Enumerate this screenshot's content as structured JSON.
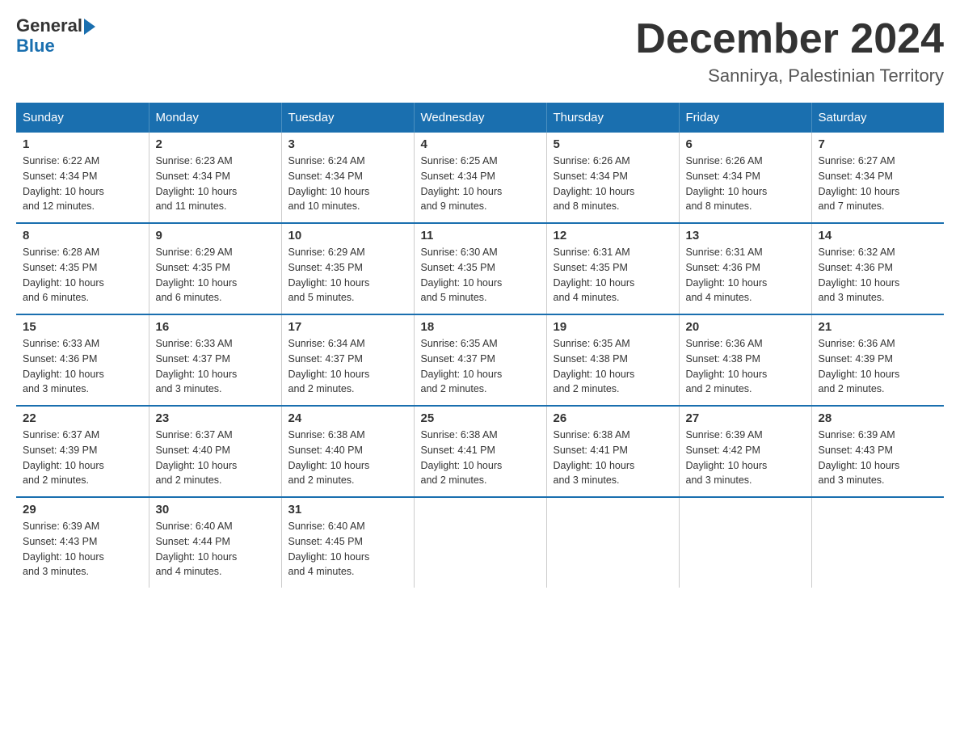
{
  "header": {
    "logo_line1": "General",
    "logo_line2": "Blue",
    "month_title": "December 2024",
    "location": "Sannirya, Palestinian Territory"
  },
  "days_of_week": [
    "Sunday",
    "Monday",
    "Tuesday",
    "Wednesday",
    "Thursday",
    "Friday",
    "Saturday"
  ],
  "weeks": [
    [
      {
        "day": "1",
        "sunrise": "6:22 AM",
        "sunset": "4:34 PM",
        "daylight": "10 hours and 12 minutes."
      },
      {
        "day": "2",
        "sunrise": "6:23 AM",
        "sunset": "4:34 PM",
        "daylight": "10 hours and 11 minutes."
      },
      {
        "day": "3",
        "sunrise": "6:24 AM",
        "sunset": "4:34 PM",
        "daylight": "10 hours and 10 minutes."
      },
      {
        "day": "4",
        "sunrise": "6:25 AM",
        "sunset": "4:34 PM",
        "daylight": "10 hours and 9 minutes."
      },
      {
        "day": "5",
        "sunrise": "6:26 AM",
        "sunset": "4:34 PM",
        "daylight": "10 hours and 8 minutes."
      },
      {
        "day": "6",
        "sunrise": "6:26 AM",
        "sunset": "4:34 PM",
        "daylight": "10 hours and 8 minutes."
      },
      {
        "day": "7",
        "sunrise": "6:27 AM",
        "sunset": "4:34 PM",
        "daylight": "10 hours and 7 minutes."
      }
    ],
    [
      {
        "day": "8",
        "sunrise": "6:28 AM",
        "sunset": "4:35 PM",
        "daylight": "10 hours and 6 minutes."
      },
      {
        "day": "9",
        "sunrise": "6:29 AM",
        "sunset": "4:35 PM",
        "daylight": "10 hours and 6 minutes."
      },
      {
        "day": "10",
        "sunrise": "6:29 AM",
        "sunset": "4:35 PM",
        "daylight": "10 hours and 5 minutes."
      },
      {
        "day": "11",
        "sunrise": "6:30 AM",
        "sunset": "4:35 PM",
        "daylight": "10 hours and 5 minutes."
      },
      {
        "day": "12",
        "sunrise": "6:31 AM",
        "sunset": "4:35 PM",
        "daylight": "10 hours and 4 minutes."
      },
      {
        "day": "13",
        "sunrise": "6:31 AM",
        "sunset": "4:36 PM",
        "daylight": "10 hours and 4 minutes."
      },
      {
        "day": "14",
        "sunrise": "6:32 AM",
        "sunset": "4:36 PM",
        "daylight": "10 hours and 3 minutes."
      }
    ],
    [
      {
        "day": "15",
        "sunrise": "6:33 AM",
        "sunset": "4:36 PM",
        "daylight": "10 hours and 3 minutes."
      },
      {
        "day": "16",
        "sunrise": "6:33 AM",
        "sunset": "4:37 PM",
        "daylight": "10 hours and 3 minutes."
      },
      {
        "day": "17",
        "sunrise": "6:34 AM",
        "sunset": "4:37 PM",
        "daylight": "10 hours and 2 minutes."
      },
      {
        "day": "18",
        "sunrise": "6:35 AM",
        "sunset": "4:37 PM",
        "daylight": "10 hours and 2 minutes."
      },
      {
        "day": "19",
        "sunrise": "6:35 AM",
        "sunset": "4:38 PM",
        "daylight": "10 hours and 2 minutes."
      },
      {
        "day": "20",
        "sunrise": "6:36 AM",
        "sunset": "4:38 PM",
        "daylight": "10 hours and 2 minutes."
      },
      {
        "day": "21",
        "sunrise": "6:36 AM",
        "sunset": "4:39 PM",
        "daylight": "10 hours and 2 minutes."
      }
    ],
    [
      {
        "day": "22",
        "sunrise": "6:37 AM",
        "sunset": "4:39 PM",
        "daylight": "10 hours and 2 minutes."
      },
      {
        "day": "23",
        "sunrise": "6:37 AM",
        "sunset": "4:40 PM",
        "daylight": "10 hours and 2 minutes."
      },
      {
        "day": "24",
        "sunrise": "6:38 AM",
        "sunset": "4:40 PM",
        "daylight": "10 hours and 2 minutes."
      },
      {
        "day": "25",
        "sunrise": "6:38 AM",
        "sunset": "4:41 PM",
        "daylight": "10 hours and 2 minutes."
      },
      {
        "day": "26",
        "sunrise": "6:38 AM",
        "sunset": "4:41 PM",
        "daylight": "10 hours and 3 minutes."
      },
      {
        "day": "27",
        "sunrise": "6:39 AM",
        "sunset": "4:42 PM",
        "daylight": "10 hours and 3 minutes."
      },
      {
        "day": "28",
        "sunrise": "6:39 AM",
        "sunset": "4:43 PM",
        "daylight": "10 hours and 3 minutes."
      }
    ],
    [
      {
        "day": "29",
        "sunrise": "6:39 AM",
        "sunset": "4:43 PM",
        "daylight": "10 hours and 3 minutes."
      },
      {
        "day": "30",
        "sunrise": "6:40 AM",
        "sunset": "4:44 PM",
        "daylight": "10 hours and 4 minutes."
      },
      {
        "day": "31",
        "sunrise": "6:40 AM",
        "sunset": "4:45 PM",
        "daylight": "10 hours and 4 minutes."
      },
      null,
      null,
      null,
      null
    ]
  ],
  "labels": {
    "sunrise": "Sunrise:",
    "sunset": "Sunset:",
    "daylight": "Daylight:"
  }
}
